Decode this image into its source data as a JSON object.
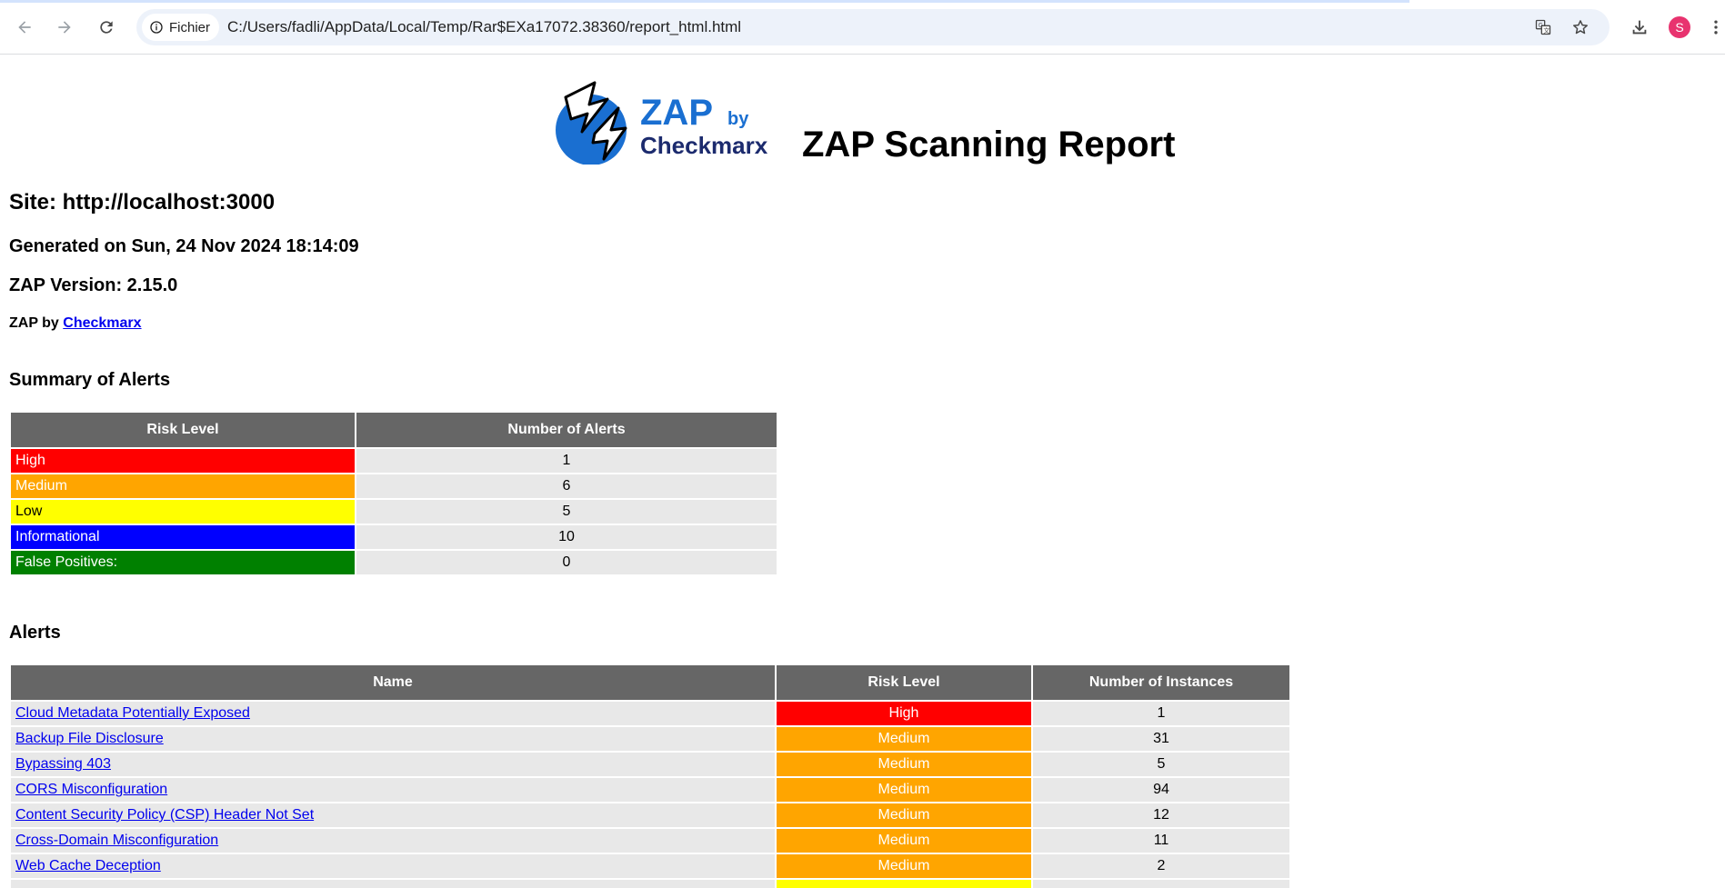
{
  "browser": {
    "chip_label": "Fichier",
    "url": "C:/Users/fadli/AppData/Local/Temp/Rar$EXa17072.38360/report_html.html",
    "avatar_initial": "S",
    "icons": [
      "back-icon",
      "forward-icon",
      "reload-icon",
      "info-icon",
      "translate-icon",
      "star-icon",
      "download-icon",
      "more-icon"
    ]
  },
  "report": {
    "logo": {
      "word1": "ZAP",
      "word2": "by",
      "word3": "Checkmarx"
    },
    "title": "ZAP Scanning Report",
    "site": "Site: http://localhost:3000",
    "generated": "Generated on Sun, 24 Nov 2024 18:14:09",
    "version": "ZAP Version: 2.15.0",
    "zap_by_prefix": "ZAP by ",
    "zap_by_link": "Checkmarx"
  },
  "summary": {
    "title": "Summary of Alerts",
    "headers": [
      "Risk Level",
      "Number of Alerts"
    ],
    "rows": [
      {
        "level": "High",
        "count": "1",
        "color": "#ff0000"
      },
      {
        "level": "Medium",
        "count": "6",
        "color": "#ffa500"
      },
      {
        "level": "Low",
        "count": "5",
        "color": "#ffff00"
      },
      {
        "level": "Informational",
        "count": "10",
        "color": "#0000ff"
      },
      {
        "level": "False Positives:",
        "count": "0",
        "color": "#008000"
      }
    ]
  },
  "alerts": {
    "title": "Alerts",
    "headers": [
      "Name",
      "Risk Level",
      "Number of Instances"
    ],
    "rows": [
      {
        "name": "Cloud Metadata Potentially Exposed",
        "risk": "High",
        "instances": "1"
      },
      {
        "name": "Backup File Disclosure",
        "risk": "Medium",
        "instances": "31"
      },
      {
        "name": "Bypassing 403",
        "risk": "Medium",
        "instances": "5"
      },
      {
        "name": "CORS Misconfiguration",
        "risk": "Medium",
        "instances": "94"
      },
      {
        "name": "Content Security Policy (CSP) Header Not Set",
        "risk": "Medium",
        "instances": "12"
      },
      {
        "name": "Cross-Domain Misconfiguration",
        "risk": "Medium",
        "instances": "11"
      },
      {
        "name": "Web Cache Deception",
        "risk": "Medium",
        "instances": "2"
      }
    ]
  },
  "colors": {
    "high": "#ff0000",
    "medium": "#ffa500",
    "low": "#ffff00",
    "informational": "#0000ff",
    "false_positive": "#008000",
    "header_bg": "#666666",
    "row_bg": "#e8e8e8",
    "link": "#0000ee"
  }
}
